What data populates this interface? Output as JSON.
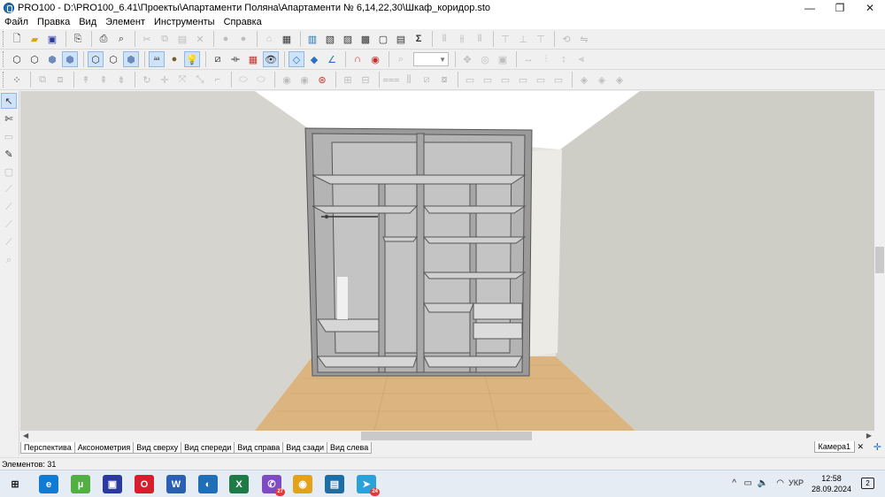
{
  "window": {
    "title": "PRO100 - D:\\PRO100_6.41\\Проекты\\Апартаменти Поляна\\Апартаменти № 6,14,22,30\\Шкаф_коридор.sto",
    "minimize": "—",
    "maximize": "❐",
    "close": "✕"
  },
  "menu": [
    "Файл",
    "Правка",
    "Вид",
    "Элемент",
    "Инструменты",
    "Справка"
  ],
  "toolbar1": {
    "sum_symbol": "Σ"
  },
  "tabs": [
    "Перспектива",
    "Аксонометрия",
    "Вид сверху",
    "Вид спереди",
    "Вид справа",
    "Вид сзади",
    "Вид слева"
  ],
  "camera_tab": {
    "label": "Камера1",
    "close": "✕",
    "add": "✛"
  },
  "status": {
    "elements": "Элементов: 31"
  },
  "taskbar": {
    "apps": [
      {
        "name": "windows-start-icon",
        "glyph": "⊞",
        "color": "#1a1a1a"
      },
      {
        "name": "edge-icon",
        "glyph": "e",
        "color": "#0f7bd4"
      },
      {
        "name": "utorrent-icon",
        "glyph": "µ",
        "color": "#52b043"
      },
      {
        "name": "save-icon",
        "glyph": "▣",
        "color": "#2b3a9e"
      },
      {
        "name": "opera-icon",
        "glyph": "O",
        "color": "#d81e2c"
      },
      {
        "name": "word-icon",
        "glyph": "W",
        "color": "#2b5fb4"
      },
      {
        "name": "pro100-icon",
        "glyph": "◐",
        "color": "#1f6fb8"
      },
      {
        "name": "excel-icon",
        "glyph": "X",
        "color": "#1e7b45"
      },
      {
        "name": "viber-icon",
        "glyph": "✆",
        "color": "#7f4bc4",
        "badge": "27"
      },
      {
        "name": "chrome-icon",
        "glyph": "◉",
        "color": "#e4a21b"
      },
      {
        "name": "photos-icon",
        "glyph": "▤",
        "color": "#1c6ea8"
      },
      {
        "name": "telegram-icon",
        "glyph": "➤",
        "color": "#2aa1d9",
        "badge": "24"
      }
    ],
    "tray_chevron": "^",
    "language": "УКР",
    "time": "12:58",
    "date": "28.09.2024",
    "notifications": "2"
  }
}
